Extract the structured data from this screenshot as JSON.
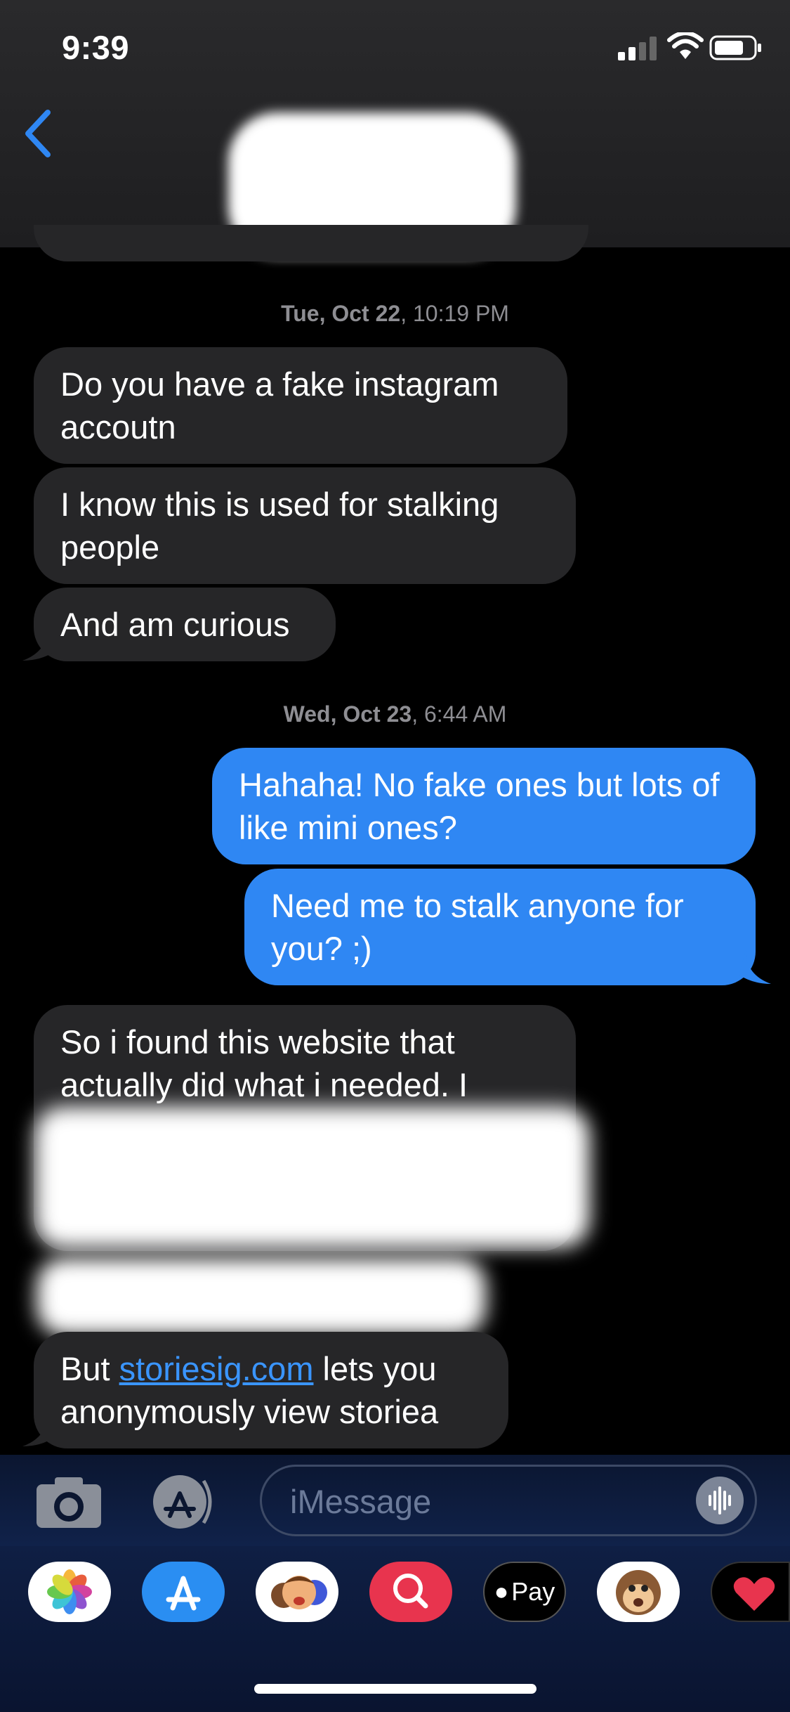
{
  "status_bar": {
    "time": "9:39"
  },
  "thread": {
    "timestamp_1": {
      "day": "Tue, Oct 22",
      "time": ", 10:19 PM"
    },
    "timestamp_2": {
      "day": "Wed, Oct 23",
      "time": ", 6:44 AM"
    },
    "incoming_1": [
      "Do you have a fake instagram accoutn",
      "I know this is used for stalking people",
      "And am curious"
    ],
    "outgoing": [
      "Hahaha! No fake ones but lots of like mini ones?",
      "Need me to stalk anyone for you? ;)"
    ],
    "incoming_2_visible": "So i found this website that actually did what i needed. I",
    "last_message": {
      "prefix": "But ",
      "link": "storiesig.com",
      "suffix": " lets you anonymously view storiea"
    }
  },
  "composer": {
    "placeholder": "iMessage"
  },
  "app_drawer": [
    {
      "name": "photos-icon"
    },
    {
      "name": "app-store-icon"
    },
    {
      "name": "memoji-icon"
    },
    {
      "name": "search-images-icon"
    },
    {
      "name": "apple-pay-icon",
      "label": "Pay"
    },
    {
      "name": "animoji-icon"
    },
    {
      "name": "digital-touch-icon"
    }
  ],
  "colors": {
    "incoming": "#262628",
    "outgoing": "#2f87f3",
    "link": "#3a95ff"
  }
}
